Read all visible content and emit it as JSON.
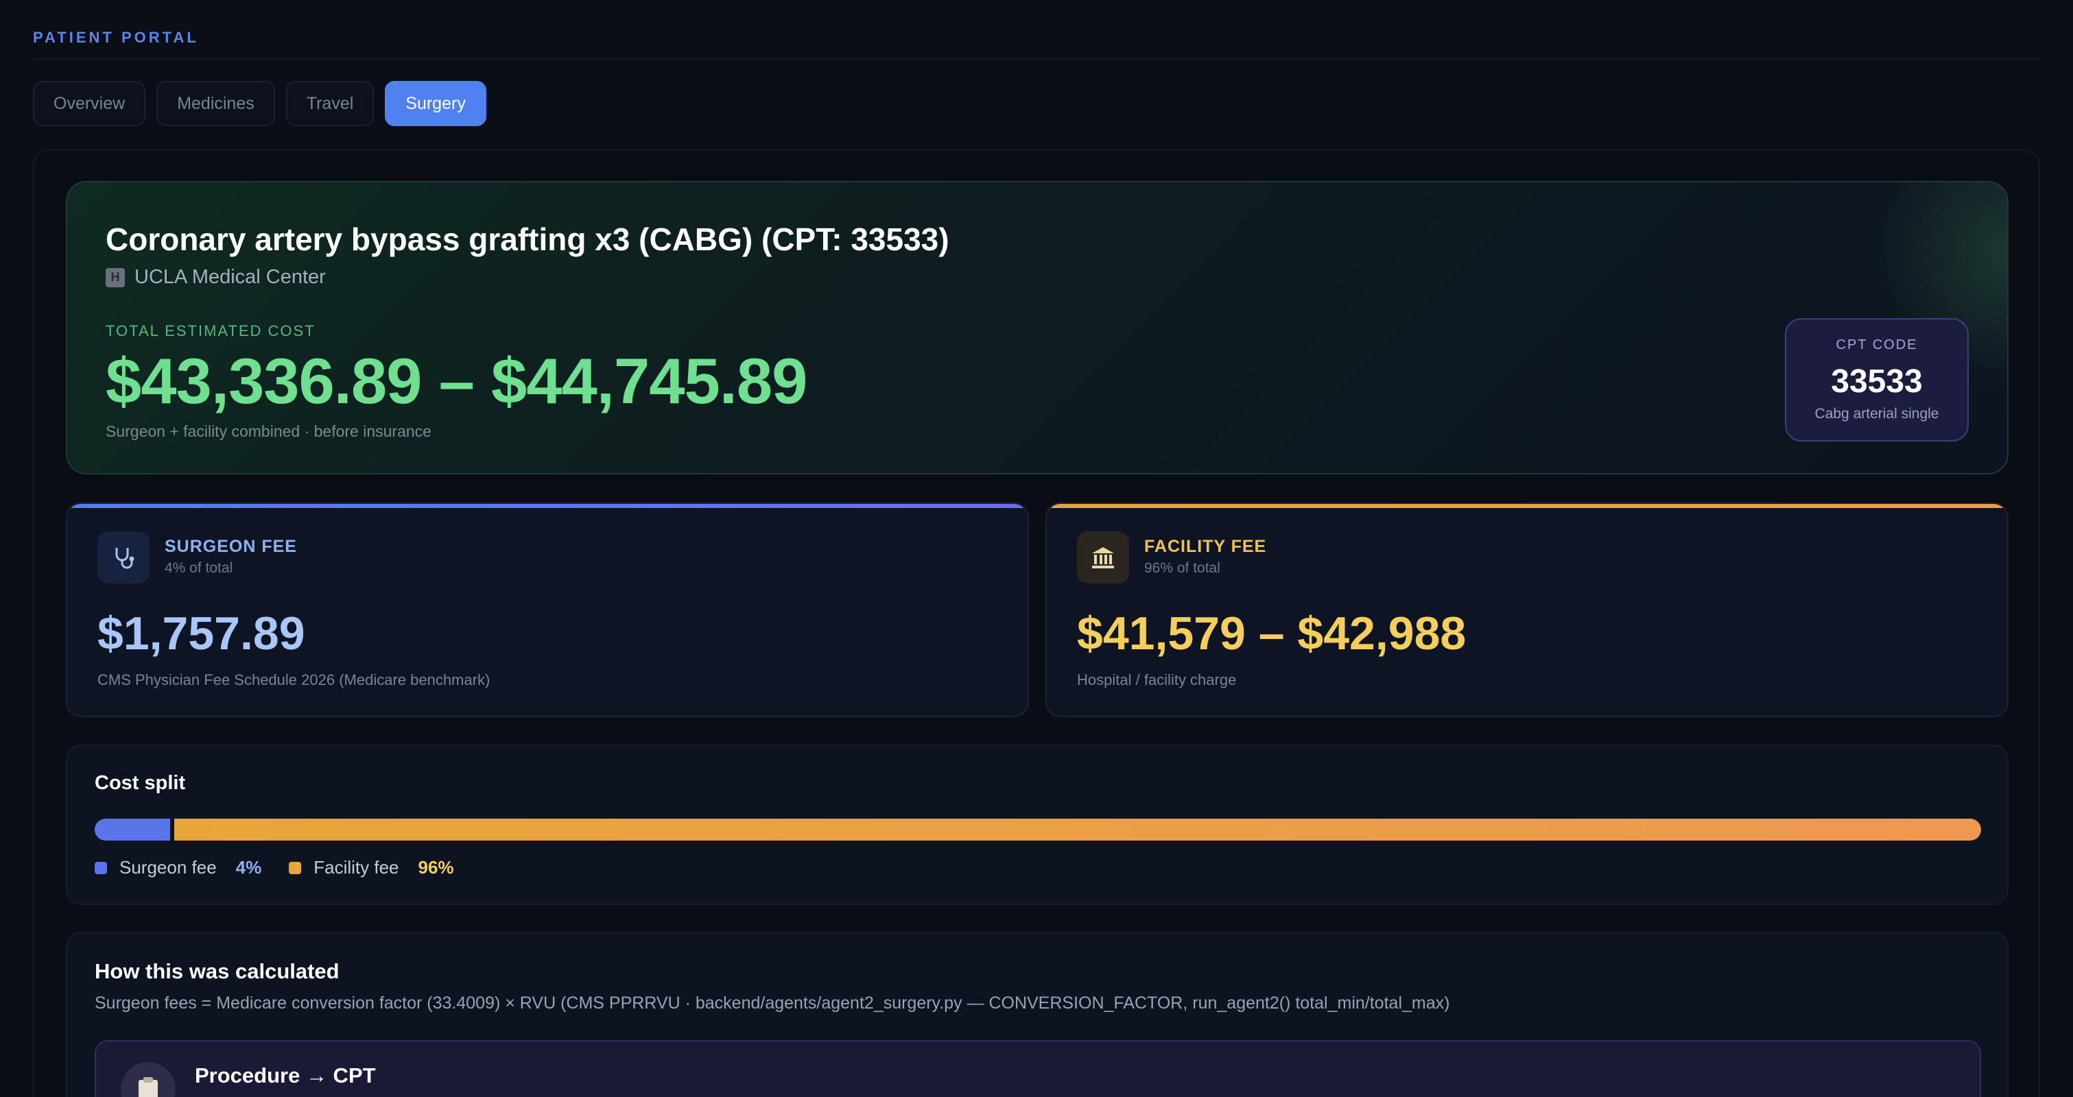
{
  "header": {
    "portal_label": "PATIENT PORTAL"
  },
  "tabs": [
    {
      "label": "Overview",
      "active": false
    },
    {
      "label": "Medicines",
      "active": false
    },
    {
      "label": "Travel",
      "active": false
    },
    {
      "label": "Surgery",
      "active": true
    }
  ],
  "hero": {
    "title": "Coronary artery bypass grafting x3 (CABG) (CPT: 33533)",
    "facility": "UCLA Medical Center",
    "facility_icon": "hospital-icon",
    "cost_label": "TOTAL ESTIMATED COST",
    "cost_range": "$43,336.89 – $44,745.89",
    "cost_note": "Surgeon + facility combined · before insurance",
    "cpt": {
      "label": "CPT CODE",
      "code": "33533",
      "description": "Cabg arterial single"
    }
  },
  "surgeon_fee": {
    "icon": "stethoscope-icon",
    "title": "SURGEON FEE",
    "share": "4% of total",
    "amount": "$1,757.89",
    "note": "CMS Physician Fee Schedule 2026 (Medicare benchmark)",
    "accent": "#4f7ef0"
  },
  "facility_fee": {
    "icon": "building-columns-icon",
    "title": "FACILITY FEE",
    "share": "96% of total",
    "amount": "$41,579 – $42,988",
    "note": "Hospital / facility charge",
    "accent": "#e6a23c"
  },
  "cost_split": {
    "title": "Cost split",
    "surgeon_fraction": 0.04,
    "facility_fraction": 0.96,
    "legend": [
      {
        "label": "Surgeon fee",
        "pct": "4%",
        "color": "#5a75ea"
      },
      {
        "label": "Facility fee",
        "pct": "96%",
        "color": "#e8a63a"
      }
    ]
  },
  "calculation": {
    "title": "How this was calculated",
    "description": "Surgeon fees = Medicare conversion factor (33.4009) × RVU (CMS PPRRVU · backend/agents/agent2_surgery.py — CONVERSION_FACTOR, run_agent2() total_min/total_max)",
    "step": {
      "icon": "clipboard-icon",
      "title": "Procedure → CPT"
    }
  }
}
